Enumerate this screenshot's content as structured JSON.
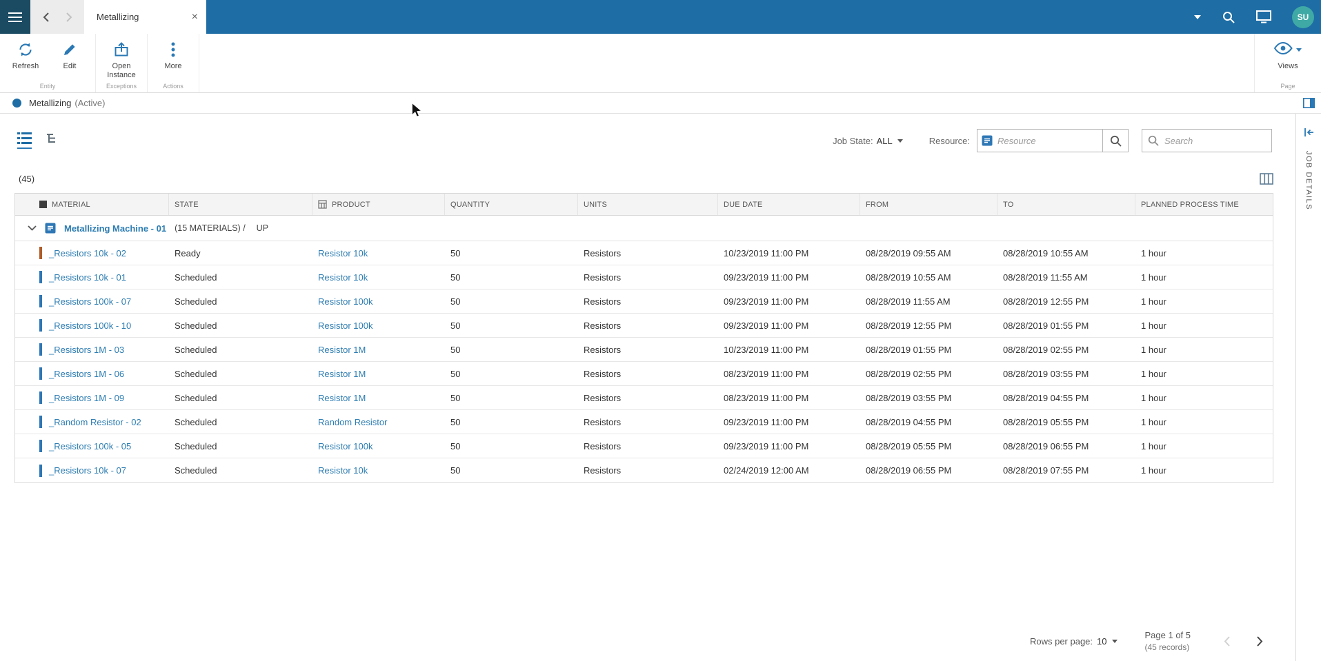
{
  "topbar": {
    "tab_title": "Metallizing",
    "avatar_initials": "SU"
  },
  "ribbon": {
    "refresh_label": "Refresh",
    "edit_label": "Edit",
    "open_instance_label": "Open Instance",
    "more_label": "More",
    "group_entity": "Entity",
    "group_exceptions": "Exceptions",
    "group_actions": "Actions",
    "views_label": "Views",
    "group_page": "Page"
  },
  "statusbar": {
    "title": "Metallizing",
    "state": "(Active)"
  },
  "filters": {
    "job_state_label": "Job State:",
    "job_state_value": "ALL",
    "resource_label": "Resource:",
    "resource_placeholder": "Resource",
    "search_placeholder": "Search"
  },
  "side_panel": {
    "label": "JOB DETAILS"
  },
  "table": {
    "count": "(45)",
    "columns": {
      "material": "MATERIAL",
      "state": "STATE",
      "product": "PRODUCT",
      "quantity": "QUANTITY",
      "units": "UNITS",
      "due_date": "DUE DATE",
      "from": "FROM",
      "to": "TO",
      "planned": "PLANNED PROCESS TIME"
    },
    "group": {
      "name": "Metallizing Machine - 01",
      "materials_count": "(15 MATERIALS) /",
      "direction": "UP"
    },
    "rows": [
      {
        "material": "_Resistors 10k - 02",
        "state": "Ready",
        "product": "Resistor 10k",
        "quantity": "50",
        "units": "Resistors",
        "due_date": "10/23/2019 11:00 PM",
        "from": "08/28/2019 09:55 AM",
        "to": "08/28/2019 10:55 AM",
        "planned": "1 hour",
        "bar_color": "#b15b28"
      },
      {
        "material": "_Resistors 10k - 01",
        "state": "Scheduled",
        "product": "Resistor 10k",
        "quantity": "50",
        "units": "Resistors",
        "due_date": "09/23/2019 11:00 PM",
        "from": "08/28/2019 10:55 AM",
        "to": "08/28/2019 11:55 AM",
        "planned": "1 hour",
        "bar_color": "#2e77b5"
      },
      {
        "material": "_Resistors 100k - 07",
        "state": "Scheduled",
        "product": "Resistor 100k",
        "quantity": "50",
        "units": "Resistors",
        "due_date": "09/23/2019 11:00 PM",
        "from": "08/28/2019 11:55 AM",
        "to": "08/28/2019 12:55 PM",
        "planned": "1 hour",
        "bar_color": "#2e77b5"
      },
      {
        "material": "_Resistors 100k - 10",
        "state": "Scheduled",
        "product": "Resistor 100k",
        "quantity": "50",
        "units": "Resistors",
        "due_date": "09/23/2019 11:00 PM",
        "from": "08/28/2019 12:55 PM",
        "to": "08/28/2019 01:55 PM",
        "planned": "1 hour",
        "bar_color": "#2e77b5"
      },
      {
        "material": "_Resistors 1M - 03",
        "state": "Scheduled",
        "product": "Resistor 1M",
        "quantity": "50",
        "units": "Resistors",
        "due_date": "10/23/2019 11:00 PM",
        "from": "08/28/2019 01:55 PM",
        "to": "08/28/2019 02:55 PM",
        "planned": "1 hour",
        "bar_color": "#2e77b5"
      },
      {
        "material": "_Resistors 1M - 06",
        "state": "Scheduled",
        "product": "Resistor 1M",
        "quantity": "50",
        "units": "Resistors",
        "due_date": "08/23/2019 11:00 PM",
        "from": "08/28/2019 02:55 PM",
        "to": "08/28/2019 03:55 PM",
        "planned": "1 hour",
        "bar_color": "#2e77b5"
      },
      {
        "material": "_Resistors 1M - 09",
        "state": "Scheduled",
        "product": "Resistor 1M",
        "quantity": "50",
        "units": "Resistors",
        "due_date": "08/23/2019 11:00 PM",
        "from": "08/28/2019 03:55 PM",
        "to": "08/28/2019 04:55 PM",
        "planned": "1 hour",
        "bar_color": "#2e77b5"
      },
      {
        "material": "_Random Resistor - 02",
        "state": "Scheduled",
        "product": "Random Resistor",
        "quantity": "50",
        "units": "Resistors",
        "due_date": "09/23/2019 11:00 PM",
        "from": "08/28/2019 04:55 PM",
        "to": "08/28/2019 05:55 PM",
        "planned": "1 hour",
        "bar_color": "#2e77b5"
      },
      {
        "material": "_Resistors 100k - 05",
        "state": "Scheduled",
        "product": "Resistor 100k",
        "quantity": "50",
        "units": "Resistors",
        "due_date": "09/23/2019 11:00 PM",
        "from": "08/28/2019 05:55 PM",
        "to": "08/28/2019 06:55 PM",
        "planned": "1 hour",
        "bar_color": "#2e77b5"
      },
      {
        "material": "_Resistors 10k - 07",
        "state": "Scheduled",
        "product": "Resistor 10k",
        "quantity": "50",
        "units": "Resistors",
        "due_date": "02/24/2019 12:00 AM",
        "from": "08/28/2019 06:55 PM",
        "to": "08/28/2019 07:55 PM",
        "planned": "1 hour",
        "bar_color": "#2e77b5"
      }
    ]
  },
  "footer": {
    "rows_per_page_label": "Rows per page:",
    "rows_per_page_value": "10",
    "page_info": "Page 1 of 5",
    "records_info": "(45 records)"
  },
  "colors": {
    "topbar": "#1e6da5",
    "topbar_dark": "#1b4a63",
    "accent": "#2a79b5",
    "link": "#2d7db3",
    "avatar": "#3fa9a5"
  }
}
